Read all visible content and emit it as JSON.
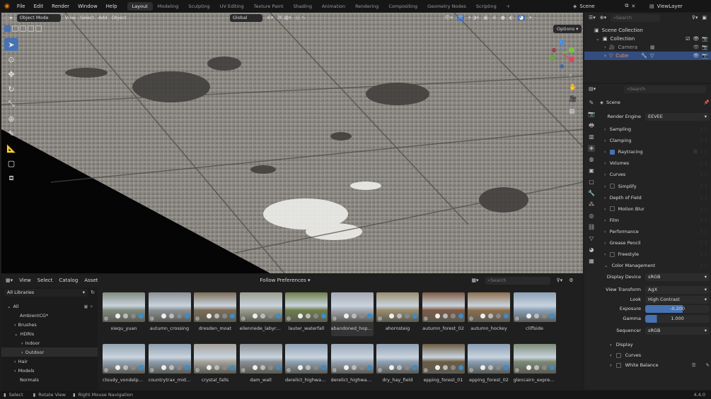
{
  "menus": [
    "File",
    "Edit",
    "Render",
    "Window",
    "Help"
  ],
  "workspaces": [
    "Layout",
    "Modeling",
    "Sculpting",
    "UV Editing",
    "Texture Paint",
    "Shading",
    "Animation",
    "Rendering",
    "Compositing",
    "Geometry Nodes",
    "Scripting"
  ],
  "scene_name": "Scene",
  "view_layer": "ViewLayer",
  "viewport": {
    "mode": "Object Mode",
    "menus": [
      "View",
      "Select",
      "Add",
      "Object"
    ],
    "orientation": "Global",
    "options": "Options"
  },
  "browser": {
    "menus": [
      "View",
      "Select",
      "Catalog",
      "Asset"
    ],
    "import_method": "Follow Preferences",
    "search_placeholder": "Search",
    "library": "All Libraries",
    "tree": [
      {
        "label": "All",
        "level": 0
      },
      {
        "label": "AmbientCG*",
        "level": 1
      },
      {
        "label": "Brushes",
        "level": 1
      },
      {
        "label": "HDRIs",
        "level": 1
      },
      {
        "label": "Indoor",
        "level": 2
      },
      {
        "label": "Outdoor",
        "level": 2
      },
      {
        "label": "Hair",
        "level": 1
      },
      {
        "label": "Models",
        "level": 1
      },
      {
        "label": "Normals",
        "level": 1
      }
    ],
    "assets": [
      "xiequ_yuan",
      "autumn_crossing",
      "dresden_moat",
      "eilenriede_labyrinth",
      "lauter_waterfall",
      "abandoned_hopp...",
      "ahornsteig",
      "autumn_forest_02",
      "autumn_hockey",
      "cliffside",
      "cloudy_vondelpark",
      "countrytrax_midday",
      "crystal_falls",
      "dam_wall",
      "derelict_highway_...",
      "derelict_highway_...",
      "dry_hay_field",
      "epping_forest_01",
      "epping_forest_02",
      "glencairn_expres..."
    ],
    "colors": [
      "#7f8a7e",
      "#8b8f93",
      "#7c6d58",
      "#9a9d8d",
      "#6f7e4a",
      "#a4a8b1",
      "#9a8c6e",
      "#7e5a45",
      "#8c6f4e",
      "#8aa1b8",
      "#93a3b1",
      "#8e9eaf",
      "#a4a29a",
      "#8a8f94",
      "#8fa1b3",
      "#9aa7b7",
      "#8fa0b3",
      "#6c5c44",
      "#8a9db3",
      "#7c8a77"
    ]
  },
  "outliner": {
    "search_placeholder": "Search",
    "items": [
      {
        "label": "Scene Collection",
        "level": 0,
        "color": "#d0d0d0"
      },
      {
        "label": "Collection",
        "level": 1,
        "color": "#ffffff"
      },
      {
        "label": "Camera",
        "level": 2,
        "color": "#9a9a9a"
      },
      {
        "label": "Cube",
        "level": 2,
        "color": "#f08a5d"
      }
    ]
  },
  "properties": {
    "search_placeholder": "Search",
    "context": "Scene",
    "render_engine_label": "Render Engine",
    "render_engine": "EEVEE",
    "panels": [
      "Sampling",
      "Clamping",
      "Raytracing",
      "Volumes",
      "Curves",
      "Simplify",
      "Depth of Field",
      "Motion Blur",
      "Film",
      "Performance",
      "Grease Pencil",
      "Freestyle",
      "Color Management"
    ],
    "cm": {
      "display_device_label": "Display Device",
      "display_device": "sRGB",
      "view_transform_label": "View Transform",
      "view_transform": "AgX",
      "look_label": "Look",
      "look": "High Contrast",
      "exposure_label": "Exposure",
      "exposure": "-0.200",
      "gamma_label": "Gamma",
      "gamma": "1.000",
      "sequencer_label": "Sequencer",
      "sequencer": "sRGB"
    },
    "sub_panels": [
      "Display",
      "Curves",
      "White Balance"
    ]
  },
  "status": {
    "select": "Select",
    "rotate": "Rotate View",
    "navigate": "Right Mouse Navigation",
    "version": "4.4.0"
  }
}
